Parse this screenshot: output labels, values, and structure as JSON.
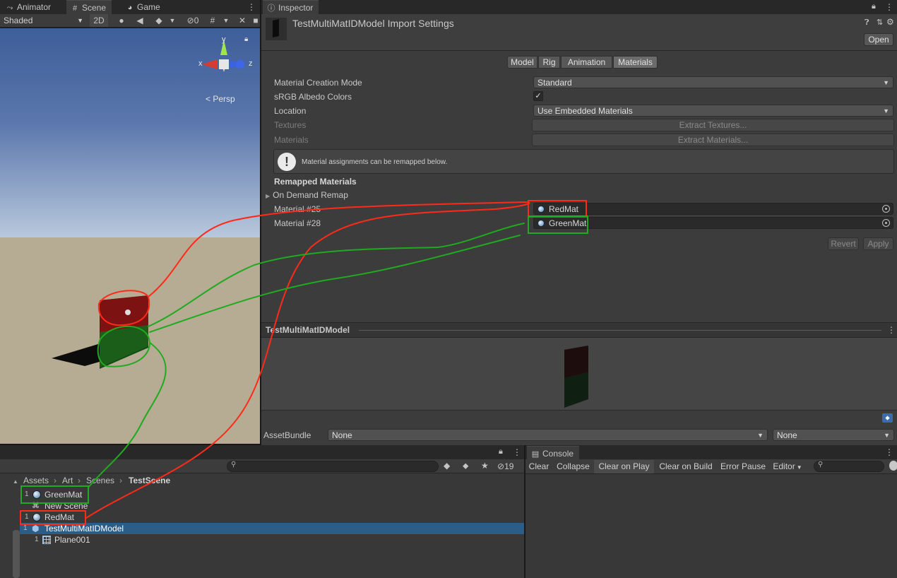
{
  "tabs_left": [
    {
      "label": "Animator",
      "icon": "animator-icon"
    },
    {
      "label": "Scene",
      "icon": "grid-icon"
    },
    {
      "label": "Game",
      "icon": "gamepad-icon"
    }
  ],
  "scene_toolbar": {
    "shading": "Shaded",
    "mode_2d": "2D",
    "hidden_count": "0"
  },
  "scene_gizmo": {
    "x_label": "x",
    "y_label": "y",
    "z_label": "z",
    "projection": "< Persp"
  },
  "inspector": {
    "tab_label": "Inspector",
    "title": "TestMultiMatIDModel Import Settings",
    "open_button": "Open",
    "import_tabs": [
      "Model",
      "Rig",
      "Animation",
      "Materials"
    ],
    "active_tab": "Materials",
    "rows": {
      "material_creation_mode_label": "Material Creation Mode",
      "material_creation_mode_value": "Standard",
      "srgb_label": "sRGB Albedo Colors",
      "srgb_checked": "✓",
      "location_label": "Location",
      "location_value": "Use Embedded Materials",
      "textures_label": "Textures",
      "extract_textures": "Extract Textures...",
      "materials_label": "Materials",
      "extract_materials": "Extract Materials..."
    },
    "info_message": "Material assignments can be remapped below.",
    "remapped_header": "Remapped Materials",
    "on_demand_remap": "On Demand Remap",
    "remaps": [
      {
        "label": "Material #25",
        "value": "RedMat"
      },
      {
        "label": "Material #28",
        "value": "GreenMat"
      }
    ],
    "revert_button": "Revert",
    "apply_button": "Apply",
    "preview_title": "TestMultiMatIDModel",
    "assetbundle_label": "AssetBundle",
    "assetbundle_value": "None",
    "assetbundle_variant": "None"
  },
  "project": {
    "hidden_count": "19",
    "breadcrumb": [
      "Assets",
      "Art",
      "Scenes",
      "TestScene"
    ],
    "items": [
      {
        "count": "1",
        "label": "GreenMat",
        "icon": "material-icon"
      },
      {
        "count": "",
        "label": "New Scene",
        "icon": "unity-scene-icon"
      },
      {
        "count": "1",
        "label": "RedMat",
        "icon": "material-icon"
      },
      {
        "count": "1",
        "label": "TestMultiMatIDModel",
        "icon": "model-icon"
      },
      {
        "count": "1",
        "label": "Plane001",
        "icon": "mesh-icon"
      }
    ]
  },
  "console": {
    "tab_label": "Console",
    "buttons": [
      "Clear",
      "Collapse",
      "Clear on Play",
      "Clear on Build",
      "Error Pause",
      "Editor"
    ]
  },
  "colors": {
    "annotation_red": "#ff2a1a",
    "annotation_green": "#1faa1f",
    "selection_blue": "#2c5d87",
    "sky_top": "#3f5f9a",
    "ground": "#b8ad95"
  }
}
